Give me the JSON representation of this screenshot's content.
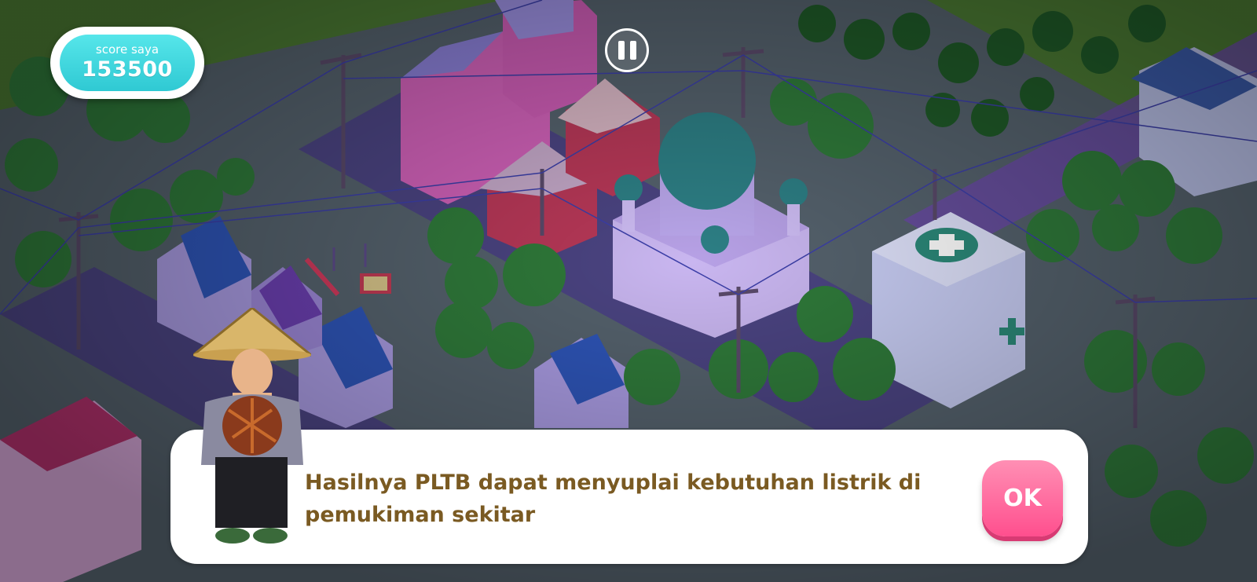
{
  "hud": {
    "score_label": "score saya",
    "score_value": "153500"
  },
  "dialog": {
    "line1": "Hasilnya PLTB dapat menyuplai kebutuhan listrik di",
    "line2": "pemukiman sekitar",
    "ok_label": "OK"
  },
  "colors": {
    "score_pill": "#3fd6dd",
    "ok_button": "#ff6a9e",
    "dialog_text": "#7a5a22",
    "scene_grass": "#3f6a2c",
    "scene_night_tint": "#6a5aa8"
  },
  "icons": {
    "pause": "pause-icon",
    "hospital": "cross-icon"
  }
}
